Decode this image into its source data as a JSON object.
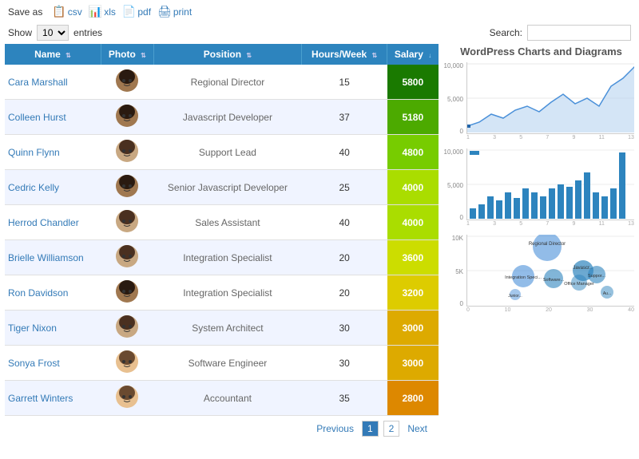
{
  "header": {
    "save_as": "Save as",
    "csv": "csv",
    "xls": "xls",
    "pdf": "pdf",
    "print": "print",
    "show_label": "Show",
    "entries_label": "entries",
    "show_value": "10",
    "search_label": "Search:"
  },
  "table": {
    "columns": [
      "Name",
      "Photo",
      "Position",
      "Hours/Week",
      "Salary"
    ],
    "rows": [
      {
        "name": "Cara Marshall",
        "position": "Regional Director",
        "hours": "15",
        "salary": "5800",
        "salary_color": "#1a7a00",
        "avatar_color": "#c8a882"
      },
      {
        "name": "Colleen Hurst",
        "position": "Javascript Developer",
        "hours": "37",
        "salary": "5180",
        "salary_color": "#4caa00",
        "avatar_color": "#c8a882"
      },
      {
        "name": "Quinn Flynn",
        "position": "Support Lead",
        "hours": "40",
        "salary": "4800",
        "salary_color": "#77cc00",
        "avatar_color": "#c8a882"
      },
      {
        "name": "Cedric Kelly",
        "position": "Senior Javascript Developer",
        "hours": "25",
        "salary": "4000",
        "salary_color": "#aadd00",
        "avatar_color": "#a07850"
      },
      {
        "name": "Herrod Chandler",
        "position": "Sales Assistant",
        "hours": "40",
        "salary": "4000",
        "salary_color": "#aadd00",
        "avatar_color": "#a07850"
      },
      {
        "name": "Brielle Williamson",
        "position": "Integration Specialist",
        "hours": "20",
        "salary": "3600",
        "salary_color": "#ccdd00",
        "avatar_color": "#c8a882"
      },
      {
        "name": "Ron Davidson",
        "position": "Integration Specialist",
        "hours": "20",
        "salary": "3200",
        "salary_color": "#ddcc00",
        "avatar_color": "#c8a882"
      },
      {
        "name": "Tiger Nixon",
        "position": "System Architect",
        "hours": "30",
        "salary": "3000",
        "salary_color": "#ddaa00",
        "avatar_color": "#a07850"
      },
      {
        "name": "Sonya Frost",
        "position": "Software Engineer",
        "hours": "30",
        "salary": "3000",
        "salary_color": "#ddaa00",
        "avatar_color": "#c8a882"
      },
      {
        "name": "Garrett Winters",
        "position": "Accountant",
        "hours": "35",
        "salary": "2800",
        "salary_color": "#dd8800",
        "avatar_color": "#e8c090"
      }
    ]
  },
  "pagination": {
    "previous": "Previous",
    "next": "Next",
    "pages": [
      "1",
      "2"
    ],
    "current": "1"
  },
  "charts": {
    "title": "WordPress Charts and Diagrams"
  }
}
